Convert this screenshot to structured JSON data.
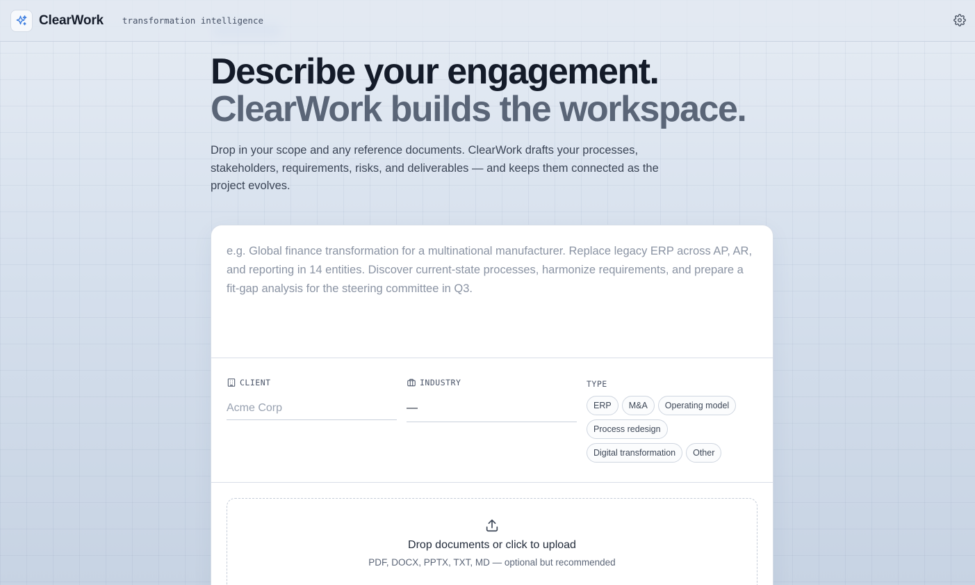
{
  "header": {
    "brand": "ClearWork",
    "tagline": "transformation intelligence",
    "logo_icon": "sparkle-icon",
    "settings_icon": "gear-icon",
    "accent_color": "#3b7de0"
  },
  "hero": {
    "title_line1": "Describe your engagement.",
    "title_line2": "ClearWork builds the workspace.",
    "description": "Drop in your scope and any reference documents. ClearWork drafts your processes, stakeholders, requirements, risks, and deliverables — and keeps them connected as the project evolves."
  },
  "form": {
    "scope_placeholder": "e.g. Global finance transformation for a multinational manufacturer. Replace legacy ERP across AP, AR, and reporting in 14 entities. Discover current-state processes, harmonize requirements, and prepare a fit-gap analysis for the steering committee in Q3.",
    "client": {
      "label": "CLIENT",
      "icon": "building-icon",
      "placeholder": "Acme Corp",
      "value": ""
    },
    "industry": {
      "label": "INDUSTRY",
      "icon": "briefcase-icon",
      "value": "—"
    },
    "type": {
      "label": "TYPE",
      "options": [
        "ERP",
        "M&A",
        "Operating model",
        "Process redesign",
        "Digital transformation",
        "Other"
      ]
    },
    "upload": {
      "icon": "upload-icon",
      "title": "Drop documents or click to upload",
      "subtitle": "PDF, DOCX, PPTX, TXT, MD — optional but recommended"
    }
  }
}
